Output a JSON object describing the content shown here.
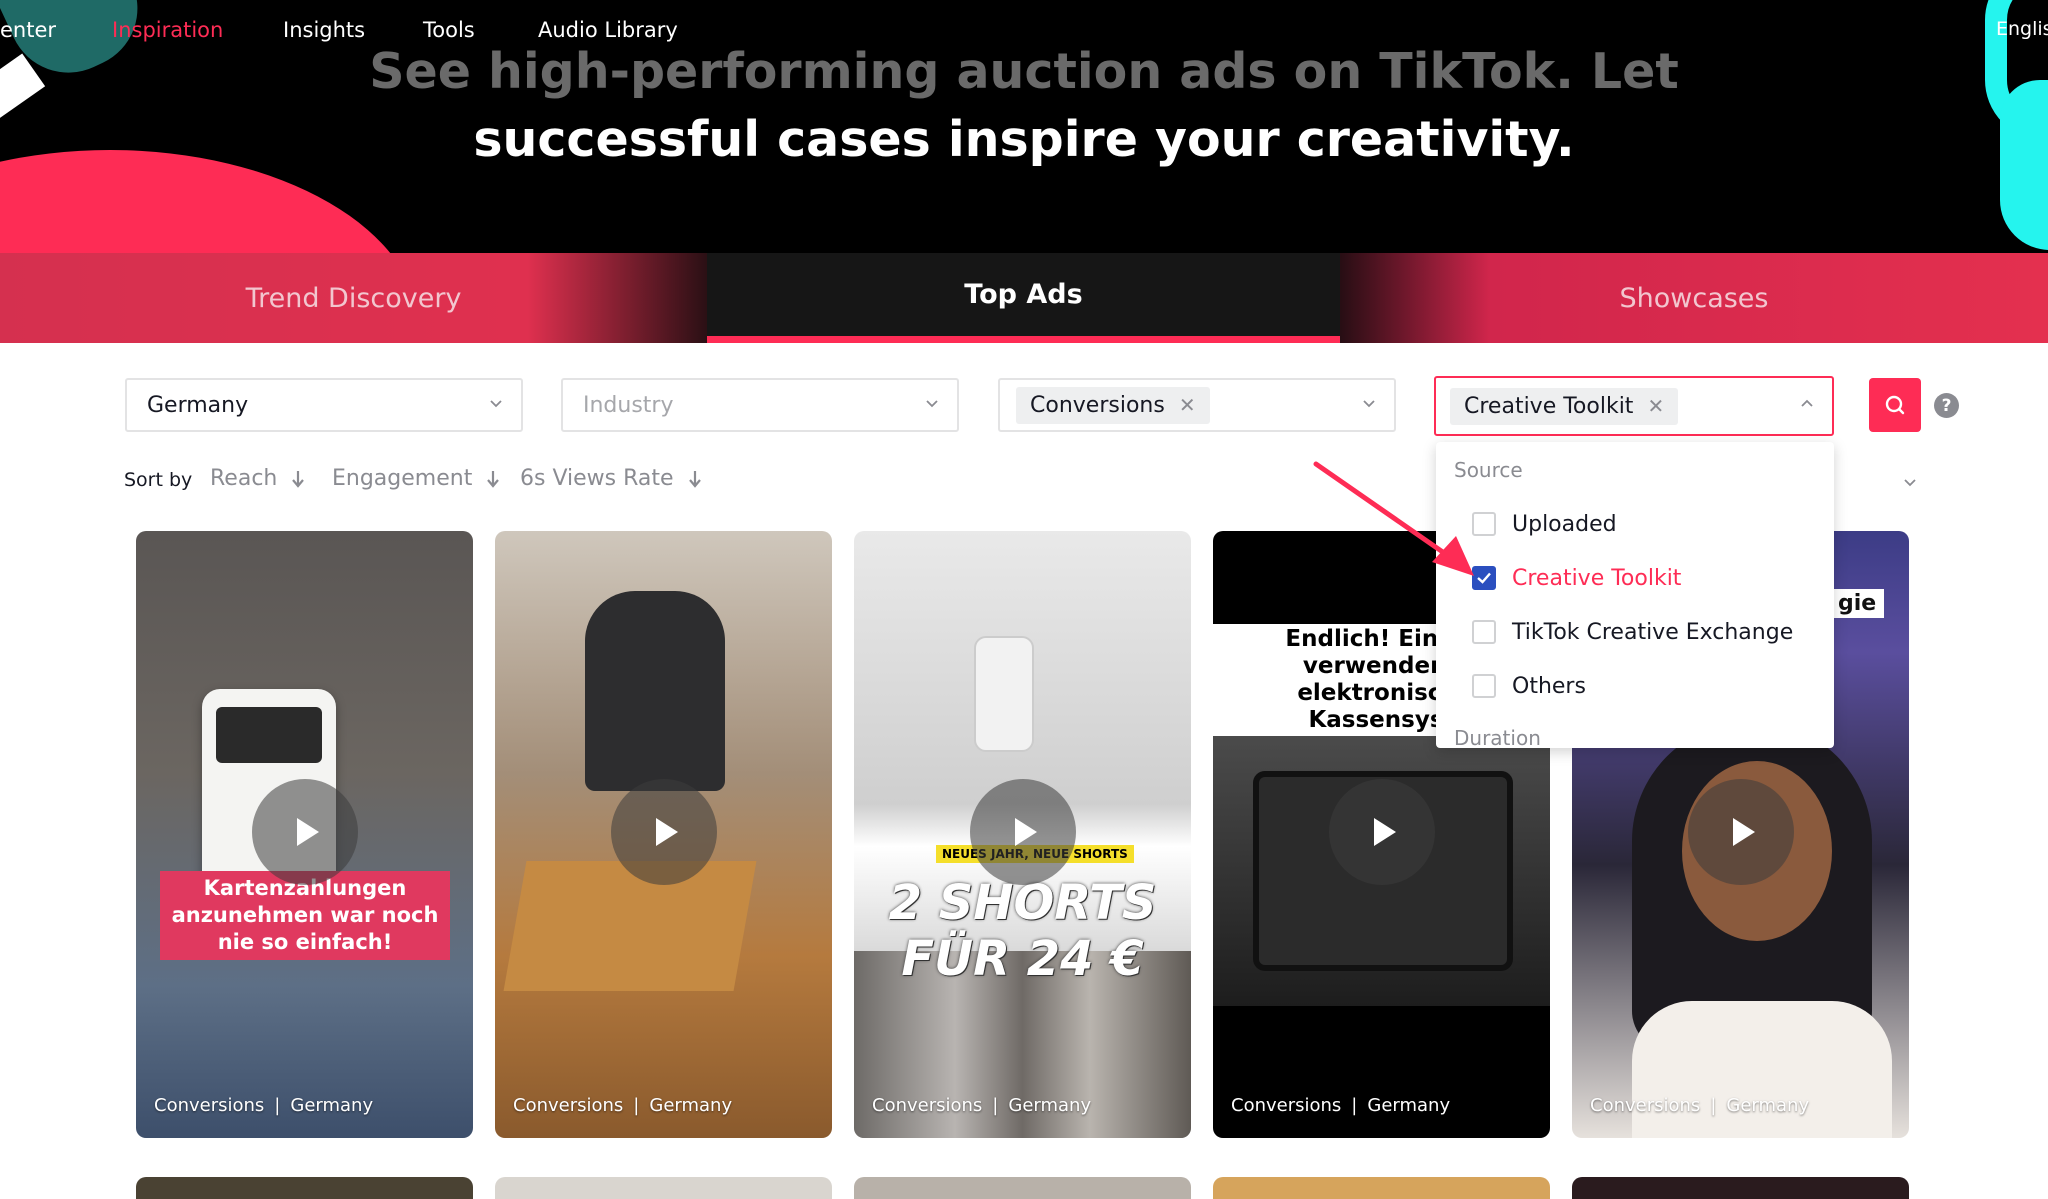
{
  "nav": {
    "center_label": "enter",
    "links": [
      "Inspiration",
      "Insights",
      "Tools",
      "Audio Library"
    ],
    "active_link": "Inspiration",
    "language": "English"
  },
  "hero": {
    "line1": "See high-performing auction ads on TikTok. Let",
    "line2": "successful cases inspire your creativity."
  },
  "tabs": [
    {
      "label": "Trend Discovery",
      "active": false
    },
    {
      "label": "Top Ads",
      "active": true
    },
    {
      "label": "Showcases",
      "active": false
    }
  ],
  "filters": {
    "region": {
      "value": "Germany"
    },
    "industry": {
      "placeholder": "Industry"
    },
    "objective": {
      "chip": "Conversions"
    },
    "source": {
      "chip": "Creative Toolkit",
      "open": true
    }
  },
  "colors": {
    "accent": "#fe2c55",
    "checkbox_checked": "#2b4fbf",
    "teal": "#25f4ee"
  },
  "icons": {
    "search": "search-icon",
    "help": "help-icon",
    "dropdown": "chevron-down-icon",
    "play": "play-icon"
  },
  "sort": {
    "label": "Sort by",
    "options": [
      "Reach",
      "Engagement",
      "6s Views Rate"
    ]
  },
  "dropdown_panel": {
    "source_heading": "Source",
    "options": [
      {
        "label": "Uploaded",
        "checked": false
      },
      {
        "label": "Creative Toolkit",
        "checked": true
      },
      {
        "label": "TikTok Creative Exchange",
        "checked": false
      },
      {
        "label": "Others",
        "checked": false
      }
    ],
    "duration_heading": "Duration"
  },
  "cards": [
    {
      "objective": "Conversions",
      "country": "Germany",
      "caption": "Kartenzahlungen anzunehmen war noch nie so einfach!"
    },
    {
      "objective": "Conversions",
      "country": "Germany"
    },
    {
      "objective": "Conversions",
      "country": "Germany",
      "caption": "2 SHORTS FÜR 24 €",
      "tag": "NEUES JAHR, NEUE SHORTS"
    },
    {
      "objective": "Conversions",
      "country": "Germany",
      "caption": "Endlich! Ein lei verwendenc elektronischl Kassensyst"
    },
    {
      "objective": "Conversions",
      "country": "Germany",
      "caption": "gie"
    }
  ]
}
